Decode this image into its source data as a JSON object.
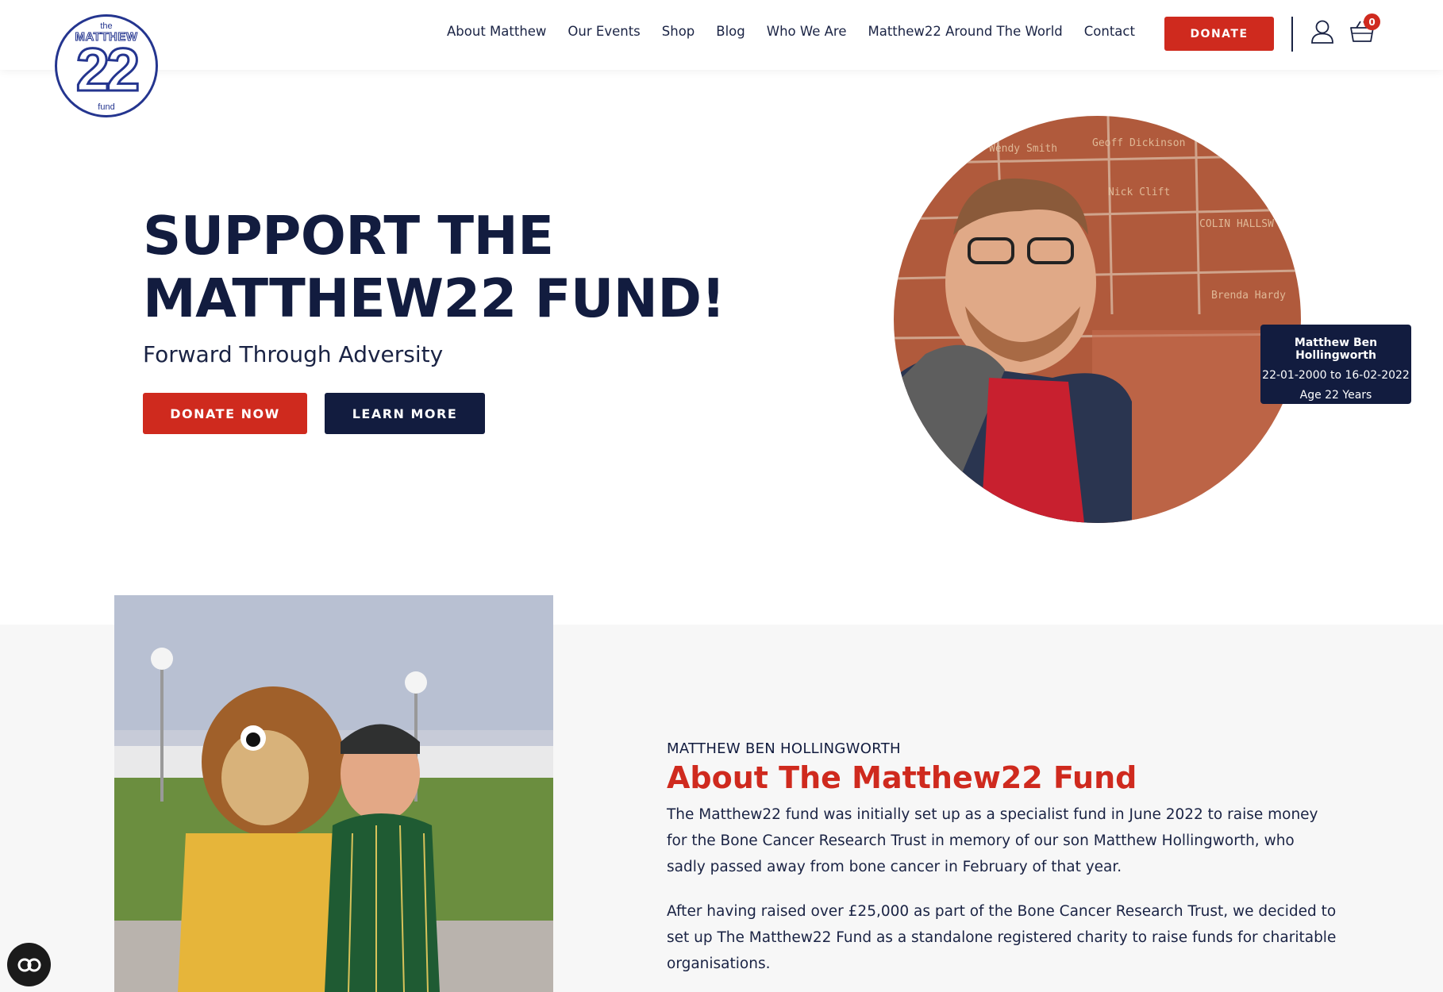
{
  "logo": {
    "the": "the",
    "matthew": "MATTHEW",
    "number": "22",
    "fund": "fund"
  },
  "nav": {
    "items": [
      "About Matthew",
      "Our Events",
      "Shop",
      "Blog",
      "Who We Are",
      "Matthew22 Around The World",
      "Contact"
    ],
    "donate_label": "DONATE",
    "cart_count": "0"
  },
  "hero": {
    "title": "SUPPORT THE\nMATTHEW22 FUND!",
    "subtitle": "Forward Through Adversity",
    "donate_now_label": "DONATE NOW",
    "learn_more_label": "LEARN MORE",
    "caption": {
      "name": "Matthew Ben Hollingworth",
      "dates": "22-01-2000 to 16-02-2022",
      "age": "Age 22 Years"
    }
  },
  "about": {
    "kicker": "MATTHEW BEN HOLLINGWORTH",
    "title": "About The Matthew22 Fund",
    "paragraph1": "The Matthew22 fund was initially set up as a specialist fund in June 2022 to raise money for the Bone Cancer Research Trust in memory of our son Matthew Hollingworth, who sadly passed away from bone cancer in February of that year.",
    "paragraph2": "After having raised over £25,000 as part of the Bone Cancer Research Trust, we decided to set up The Matthew22 Fund as a standalone registered charity to raise funds for charitable organisations."
  },
  "colors": {
    "brand_red": "#cf2a1e",
    "navy": "#121c3f",
    "logo_blue": "#24358f"
  },
  "icons": [
    "user-icon",
    "cart-icon",
    "accessibility-icon"
  ]
}
